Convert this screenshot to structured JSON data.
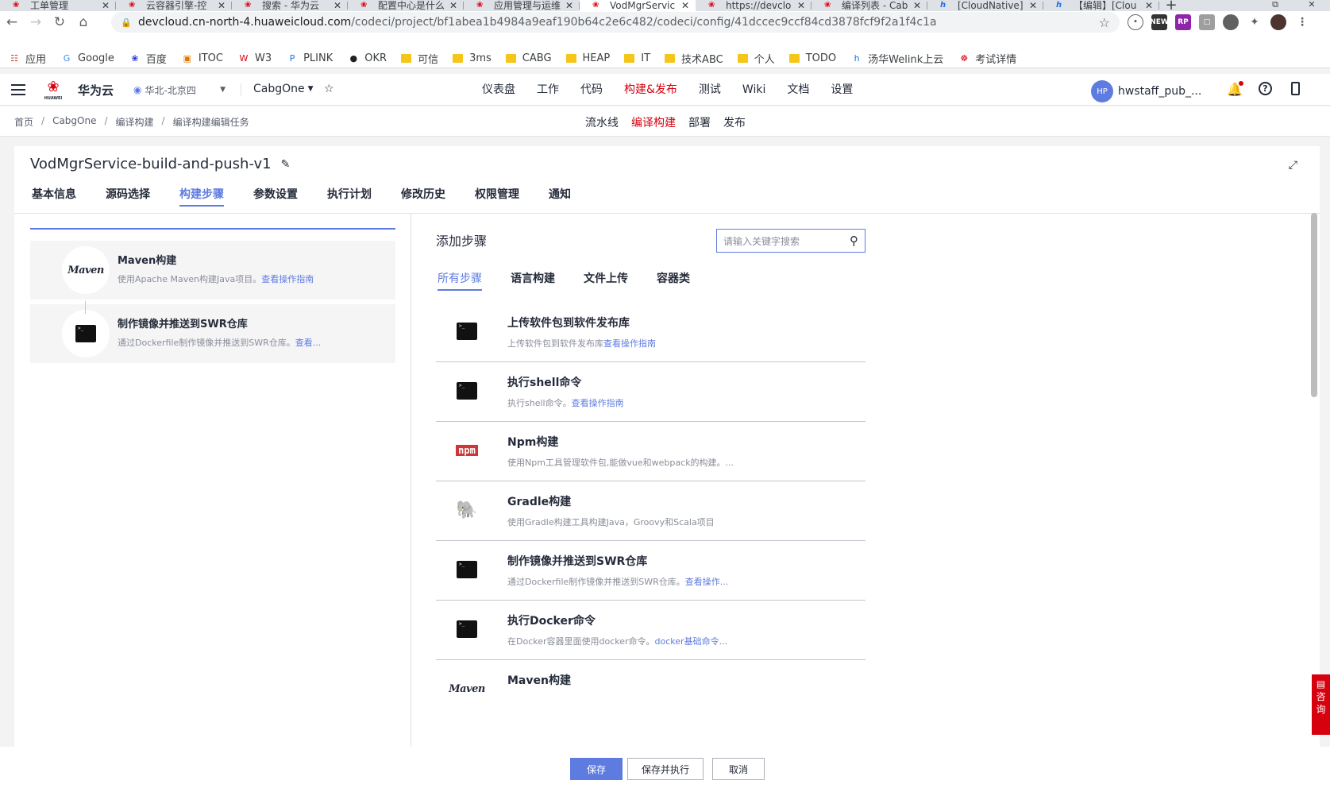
{
  "browser": {
    "tabs": [
      {
        "title": "工单管理",
        "icon": "huawei"
      },
      {
        "title": "云容器引擎-控",
        "icon": "huawei"
      },
      {
        "title": "搜索 - 华为云",
        "icon": "huawei"
      },
      {
        "title": "配置中心是什么",
        "icon": "huawei"
      },
      {
        "title": "应用管理与运维",
        "icon": "huawei"
      },
      {
        "title": "VodMgrServic",
        "icon": "huawei",
        "active": true
      },
      {
        "title": "https://devclo",
        "icon": "huawei"
      },
      {
        "title": "编译列表 - Cab",
        "icon": "huawei"
      },
      {
        "title": "[CloudNative]",
        "icon": "hi"
      },
      {
        "title": "【编辑】[Clou",
        "icon": "hi"
      }
    ],
    "url_host": "devcloud.cn-north-4.huaweicloud.com",
    "url_path": "/codeci/project/bf1abea1b4984a9eaf190b64c2e6c482/codeci/config/41dccec9ccf84cd3878fcf9f2a1f4c1a",
    "bookmarks": [
      "应用",
      "Google",
      "百度",
      "ITOC",
      "W3",
      "PLINK",
      "OKR",
      "可信",
      "3ms",
      "CABG",
      "HEAP",
      "IT",
      "技术ABC",
      "个人",
      "TODO",
      "汤华Welink上云",
      "考试详情"
    ]
  },
  "header": {
    "brand": "华为云",
    "region": "华北-北京四",
    "project": "CabgOne",
    "nav": [
      "仪表盘",
      "工作",
      "代码",
      "构建&发布",
      "测试",
      "Wiki",
      "文档",
      "设置"
    ],
    "nav_active": "构建&发布",
    "avatar": "HP",
    "username": "hwstaff_pub_..."
  },
  "subheader": {
    "breadcrumbs": [
      "首页",
      "CabgOne",
      "编译构建",
      "编译构建编辑任务"
    ],
    "subnav": [
      "流水线",
      "编译构建",
      "部署",
      "发布"
    ],
    "subnav_active": "编译构建"
  },
  "job": {
    "title": "VodMgrService-build-and-push-v1",
    "tabs": [
      "基本信息",
      "源码选择",
      "构建步骤",
      "参数设置",
      "执行计划",
      "修改历史",
      "权限管理",
      "通知"
    ],
    "active_tab": "构建步骤"
  },
  "selected_steps": [
    {
      "name": "Maven构建",
      "desc": "使用Apache Maven构建Java项目。",
      "link": "查看操作指南",
      "icon": "maven"
    },
    {
      "name": "制作镜像并推送到SWR仓库",
      "desc": "通过Dockerfile制作镜像并推送到SWR仓库。",
      "link": "查看...",
      "icon": "terminal"
    }
  ],
  "add_steps": {
    "title": "添加步骤",
    "search_placeholder": "请输入关键字搜索",
    "categories": [
      "所有步骤",
      "语言构建",
      "文件上传",
      "容器类"
    ],
    "active_category": "所有步骤",
    "items": [
      {
        "name": "上传软件包到软件发布库",
        "desc": "上传软件包到软件发布库",
        "link": "查看操作指南",
        "icon": "terminal"
      },
      {
        "name": "执行shell命令",
        "desc": "执行shell命令。",
        "link": "查看操作指南",
        "icon": "terminal"
      },
      {
        "name": "Npm构建",
        "desc": "使用Npm工具管理软件包,能做vue和webpack的构建。...",
        "link": "",
        "icon": "npm"
      },
      {
        "name": "Gradle构建",
        "desc": "使用Gradle构建工具构建Java，Groovy和Scala项目",
        "link": "",
        "icon": "gradle"
      },
      {
        "name": "制作镜像并推送到SWR仓库",
        "desc": "通过Dockerfile制作镜像并推送到SWR仓库。",
        "link": "查看操作...",
        "icon": "terminal"
      },
      {
        "name": "执行Docker命令",
        "desc": "在Docker容器里面使用docker命令。",
        "link": "docker基础命令...",
        "icon": "terminal"
      },
      {
        "name": "Maven构建",
        "desc": "",
        "link": "",
        "icon": "maven"
      }
    ]
  },
  "actions": {
    "save": "保存",
    "save_run": "保存并执行",
    "cancel": "取消"
  },
  "consult": [
    "咨",
    "询"
  ],
  "colors": {
    "brand_red": "#d7000f",
    "primary_blue": "#5e7ce0"
  }
}
